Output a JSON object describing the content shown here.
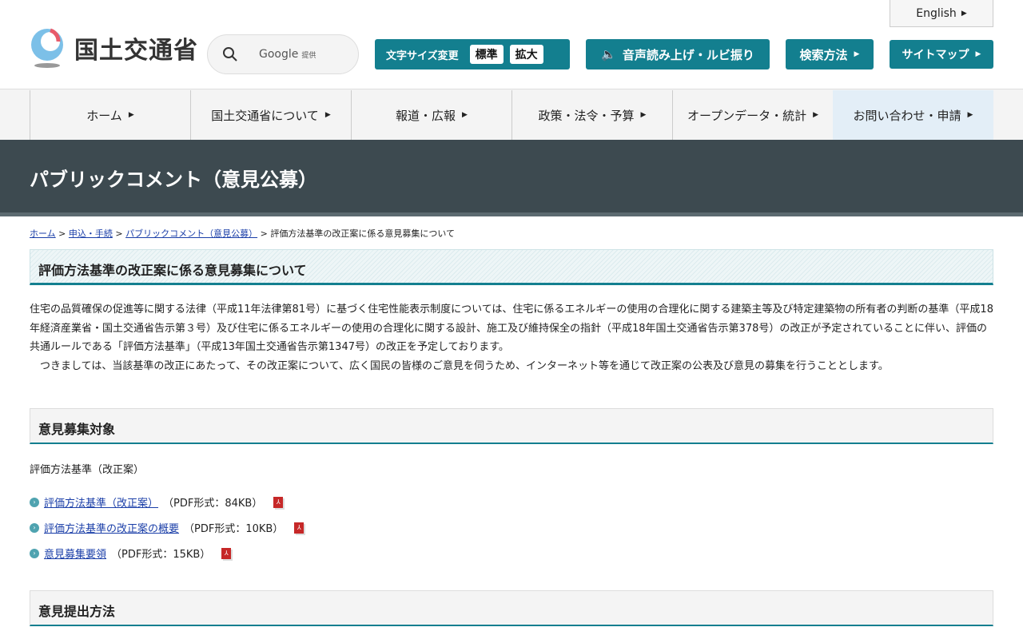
{
  "header": {
    "english": "English",
    "logo_text": "国土交通省",
    "search_brand": "Google",
    "search_provided": "提供",
    "font_size_label": "文字サイズ変更",
    "font_standard": "標準",
    "font_large": "拡大",
    "voice": "音声読み上げ・ルビ振り",
    "search_method": "検索方法",
    "sitemap": "サイトマップ"
  },
  "nav": [
    "ホーム",
    "国土交通省について",
    "報道・広報",
    "政策・法令・予算",
    "オープンデータ・統計",
    "お問い合わせ・申請"
  ],
  "banner": "パブリックコメント（意見公募）",
  "breadcrumb": {
    "items": [
      "ホーム",
      "申込・手続",
      "パブリックコメント（意見公募）"
    ],
    "current": "評価方法基準の改正案に係る意見募集について",
    "sep": ">"
  },
  "title": "評価方法基準の改正案に係る意見募集について",
  "intro": [
    "住宅の品質確保の促進等に関する法律（平成11年法律第81号）に基づく住宅性能表示制度については、住宅に係るエネルギーの使用の合理化に関する建築主等及び特定建築物の所有者の判断の基準（平成18年経済産業省・国土交通省告示第３号）及び住宅に係るエネルギーの使用の合理化に関する設計、施工及び維持保全の指針（平成18年国土交通省告示第378号）の改正が予定されていることに伴い、評価の共通ルールである「評価方法基準」（平成13年国土交通省告示第1347号）の改正を予定しております。",
    "　つきましては、当該基準の改正にあたって、その改正案について、広く国民の皆様のご意見を伺うため、インターネット等を通じて改正案の公表及び意見の募集を行うこととします。"
  ],
  "section1": {
    "heading": "意見募集対象",
    "text": "評価方法基準（改正案）",
    "links": [
      {
        "label": "評価方法基準（改正案）",
        "info": "（PDF形式：84KB）"
      },
      {
        "label": "評価方法基準の改正案の概要",
        "info": "（PDF形式：10KB）"
      },
      {
        "label": "意見募集要領",
        "info": "（PDF形式：15KB）"
      }
    ]
  },
  "section2": {
    "heading": "意見提出方法"
  },
  "colors": {
    "accent": "#137f8f",
    "banner": "#3d4a50"
  }
}
